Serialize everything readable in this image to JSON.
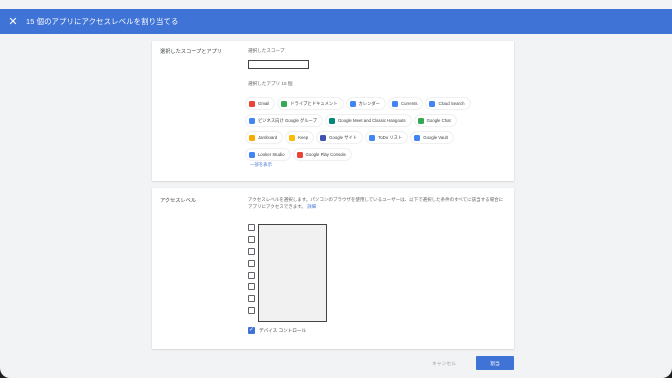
{
  "header": {
    "close_icon": "close-icon",
    "title": "15 個のアプリにアクセスレベルを割り当てる"
  },
  "scope_section": {
    "label": "選択したスコープとアプリ",
    "scope_heading": "選択したスコープ",
    "apps_heading": "選択したアプリ 15 個",
    "apps": [
      [
        {
          "icon": "gmail-icon",
          "color": "#ea4335",
          "label": "Gmail"
        },
        {
          "icon": "drive-icon",
          "color": "#34a853",
          "label": "ドライブとドキュメント"
        },
        {
          "icon": "calendar-icon",
          "color": "#4285f4",
          "label": "カレンダー"
        },
        {
          "icon": "currents-icon",
          "color": "#4285f4",
          "label": "Currents"
        },
        {
          "icon": "cloud-search-icon",
          "color": "#4285f4",
          "label": "Cloud Search"
        }
      ],
      [
        {
          "icon": "groups-icon",
          "color": "#4285f4",
          "label": "ビジネス向け Google グループ"
        },
        {
          "icon": "meet-icon",
          "color": "#00897b",
          "label": "Google Meet and Classic Hangouts"
        },
        {
          "icon": "chat-icon",
          "color": "#34a853",
          "label": "Google Chat"
        }
      ],
      [
        {
          "icon": "jamboard-icon",
          "color": "#f9ab00",
          "label": "Jamboard"
        },
        {
          "icon": "keep-icon",
          "color": "#fbbc04",
          "label": "Keep"
        },
        {
          "icon": "sites-icon",
          "color": "#3f51b5",
          "label": "Google サイト"
        },
        {
          "icon": "todo-icon",
          "color": "#4285f4",
          "label": "ToDo リスト"
        },
        {
          "icon": "vault-icon",
          "color": "#4285f4",
          "label": "Google Vault"
        }
      ],
      [
        {
          "icon": "looker-studio-icon",
          "color": "#4285f4",
          "label": "Looker Studio"
        },
        {
          "icon": "play-console-icon",
          "color": "#ea4335",
          "label": "Google Play Console"
        }
      ]
    ],
    "show_less": "一部を表示"
  },
  "access_section": {
    "label": "アクセスレベル",
    "description": "アクセスレベルを選択します。パソコンのブラウザを使用しているユーザーは、以下で選択した条件のすべてに該当する場合に",
    "description_2": "アプリにアクセスできます。",
    "details_link": "詳細",
    "device_control_label": "デバイス コントロール",
    "device_control_checked": true
  },
  "footer": {
    "cancel": "キャンセル",
    "apply": "割当"
  },
  "colors": {
    "accent": "#3f73d6"
  }
}
